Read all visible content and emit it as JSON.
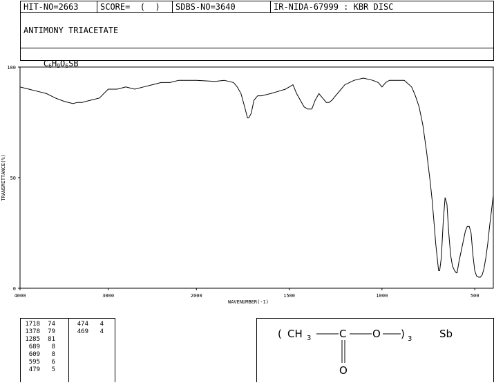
{
  "header": {
    "hit_no": "HIT-NO=2663",
    "score": "SCORE=  (  )",
    "sdbs_no": "SDBS-NO=3640",
    "ir_info": "IR-NIDA-67999 : KBR DISC"
  },
  "compound": {
    "name": "ANTIMONY TRIACETATE",
    "formula_parts": [
      {
        "t": "C",
        "sub": "6"
      },
      {
        "t": "H",
        "sub": "9"
      },
      {
        "t": "O",
        "sub": "6"
      },
      {
        "t": "SB",
        "sub": ""
      }
    ]
  },
  "chart_data": {
    "type": "line",
    "xlabel": "WAVENUMBER(-1)",
    "ylabel": "TRANSMITTANCE(%)",
    "x_range": [
      4000,
      400
    ],
    "ylim": [
      0,
      100
    ],
    "x_ticks": [
      4000,
      3000,
      2000,
      1500,
      1000,
      500
    ],
    "y_ticks": [
      0,
      50,
      100
    ],
    "series": [
      {
        "x": [
          4000,
          3900,
          3800,
          3700,
          3600,
          3500,
          3400,
          3350,
          3300,
          3200,
          3100,
          3000,
          2900,
          2800,
          2700,
          2600,
          2500,
          2400,
          2300,
          2200,
          2100,
          2000,
          1900,
          1850,
          1800,
          1780,
          1760,
          1740,
          1725,
          1718,
          1705,
          1690,
          1670,
          1650,
          1600,
          1560,
          1520,
          1500,
          1480,
          1460,
          1440,
          1420,
          1400,
          1378,
          1360,
          1340,
          1320,
          1300,
          1285,
          1270,
          1250,
          1220,
          1200,
          1150,
          1100,
          1050,
          1020,
          1000,
          980,
          960,
          940,
          920,
          880,
          840,
          820,
          800,
          780,
          760,
          740,
          730,
          720,
          710,
          700,
          695,
          689,
          680,
          670,
          660,
          650,
          640,
          630,
          620,
          609,
          600,
          595,
          585,
          570,
          560,
          550,
          540,
          530,
          520,
          510,
          500,
          490,
          479,
          470,
          460,
          450,
          440,
          430,
          420,
          410,
          400
        ],
        "y": [
          91,
          90,
          89,
          88,
          86,
          84.5,
          83.5,
          84,
          84,
          85,
          86,
          90,
          90,
          91,
          90,
          91,
          92,
          93,
          93,
          94,
          94,
          94,
          93.5,
          94,
          93,
          91,
          88,
          82,
          77,
          77,
          79,
          85,
          87,
          87,
          88,
          89,
          90,
          91,
          92,
          88,
          85,
          82,
          81,
          81,
          85,
          88,
          86,
          84,
          84,
          85,
          87,
          90,
          92,
          94,
          95,
          94,
          93,
          91,
          93,
          94,
          94,
          94,
          94,
          91,
          87,
          82,
          74,
          62,
          48,
          40,
          30,
          20,
          12,
          8,
          8,
          14,
          30,
          41,
          38,
          25,
          15,
          10,
          8,
          7,
          7,
          12,
          18,
          22,
          26,
          28,
          28,
          25,
          15,
          8,
          5.5,
          5,
          5,
          6,
          9,
          14,
          20,
          28,
          35,
          42
        ]
      }
    ]
  },
  "peaks": {
    "col1": [
      {
        "wn": "1718",
        "t": "74"
      },
      {
        "wn": "1378",
        "t": "79"
      },
      {
        "wn": "1285",
        "t": "81"
      },
      {
        "wn": "689",
        "t": "8"
      },
      {
        "wn": "609",
        "t": "8"
      },
      {
        "wn": "595",
        "t": "6"
      },
      {
        "wn": "479",
        "t": "5"
      }
    ],
    "col2": [
      {
        "wn": "474",
        "t": "4"
      },
      {
        "wn": "469",
        "t": "4"
      }
    ]
  },
  "structure": {
    "paren_open": "(",
    "ch": "CH",
    "ch_sub": "3",
    "c": "C",
    "o": "O",
    "paren_close": ")",
    "close_sub": "3",
    "metal": "Sb",
    "carbonyl_o": "O"
  }
}
